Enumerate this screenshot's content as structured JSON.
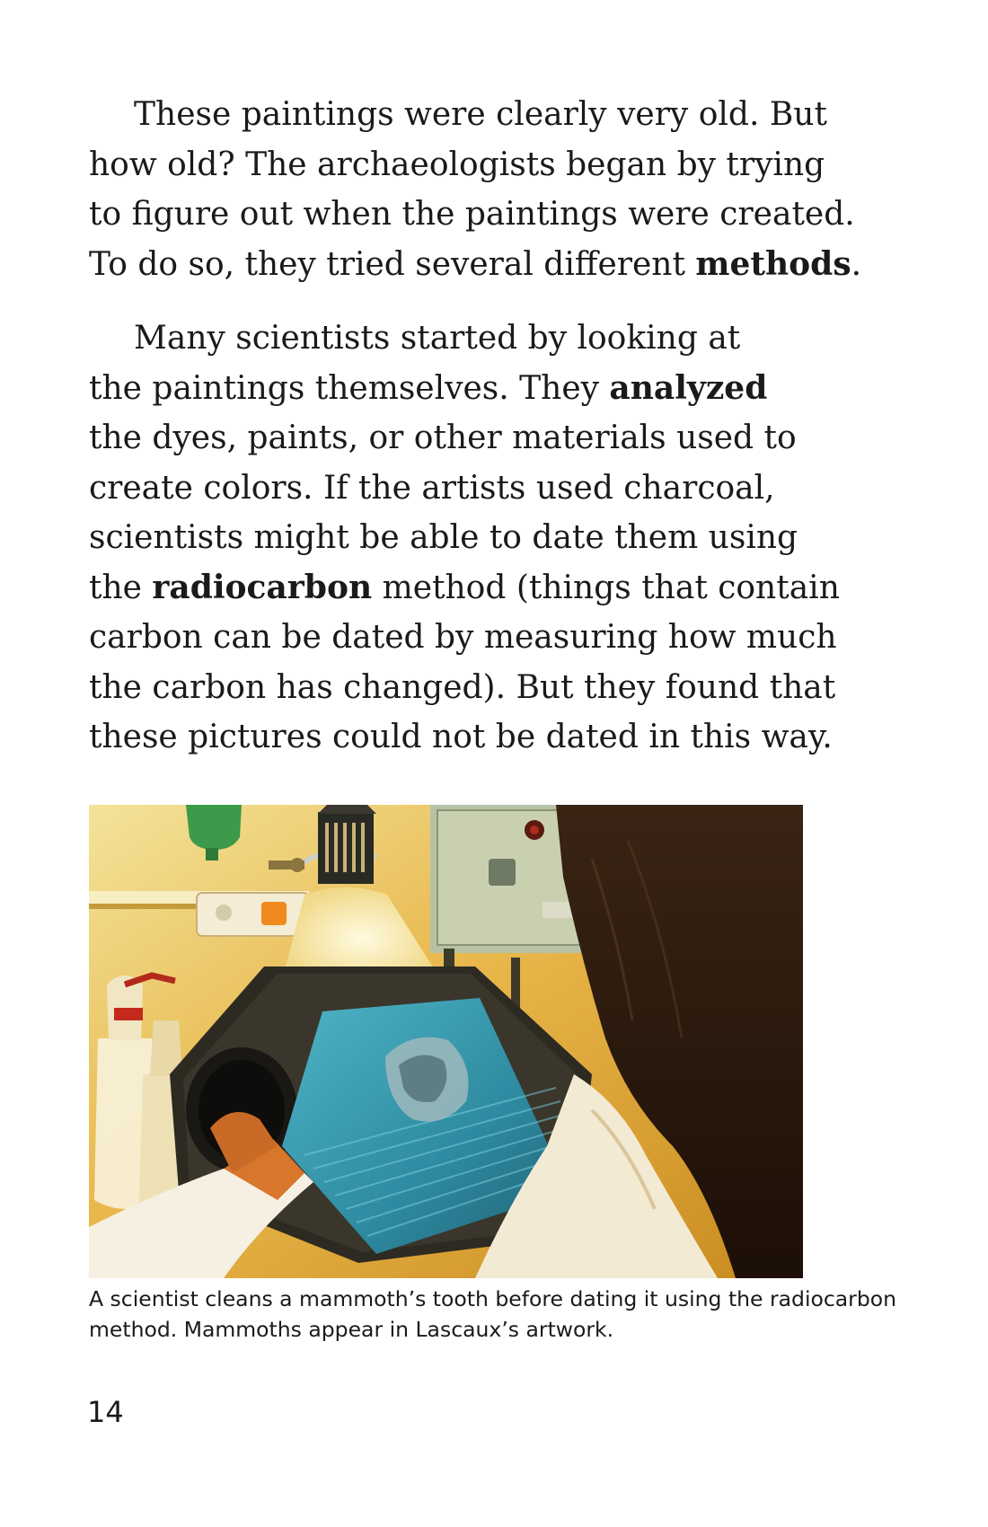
{
  "paragraphs": [
    {
      "lines": [
        [
          "These paintings were clearly very old. But"
        ],
        [
          "how old? The archaeologists began by trying"
        ],
        [
          "to figure out when the paintings were created."
        ],
        [
          "To do so, they tried several different ",
          "methods",
          "."
        ]
      ]
    },
    {
      "lines": [
        [
          "Many scientists started by looking at"
        ],
        [
          "the paintings themselves. They ",
          "analyzed"
        ],
        [
          "the dyes, paints, or other materials used to"
        ],
        [
          "create colors. If the artists used charcoal,"
        ],
        [
          "scientists might be able to date them using"
        ],
        [
          "the ",
          "radiocarbon",
          " method (things that contain"
        ],
        [
          "carbon can be dated by measuring how much"
        ],
        [
          "the carbon has changed). But they found that"
        ],
        [
          "these pictures could not be dated in this way."
        ]
      ]
    }
  ],
  "caption": {
    "line1": "A scientist cleans a mammoth’s tooth before dating it using the radiocarbon",
    "line2": "method. Mammoths appear in Lascaux’s artwork."
  },
  "page_number": "14"
}
